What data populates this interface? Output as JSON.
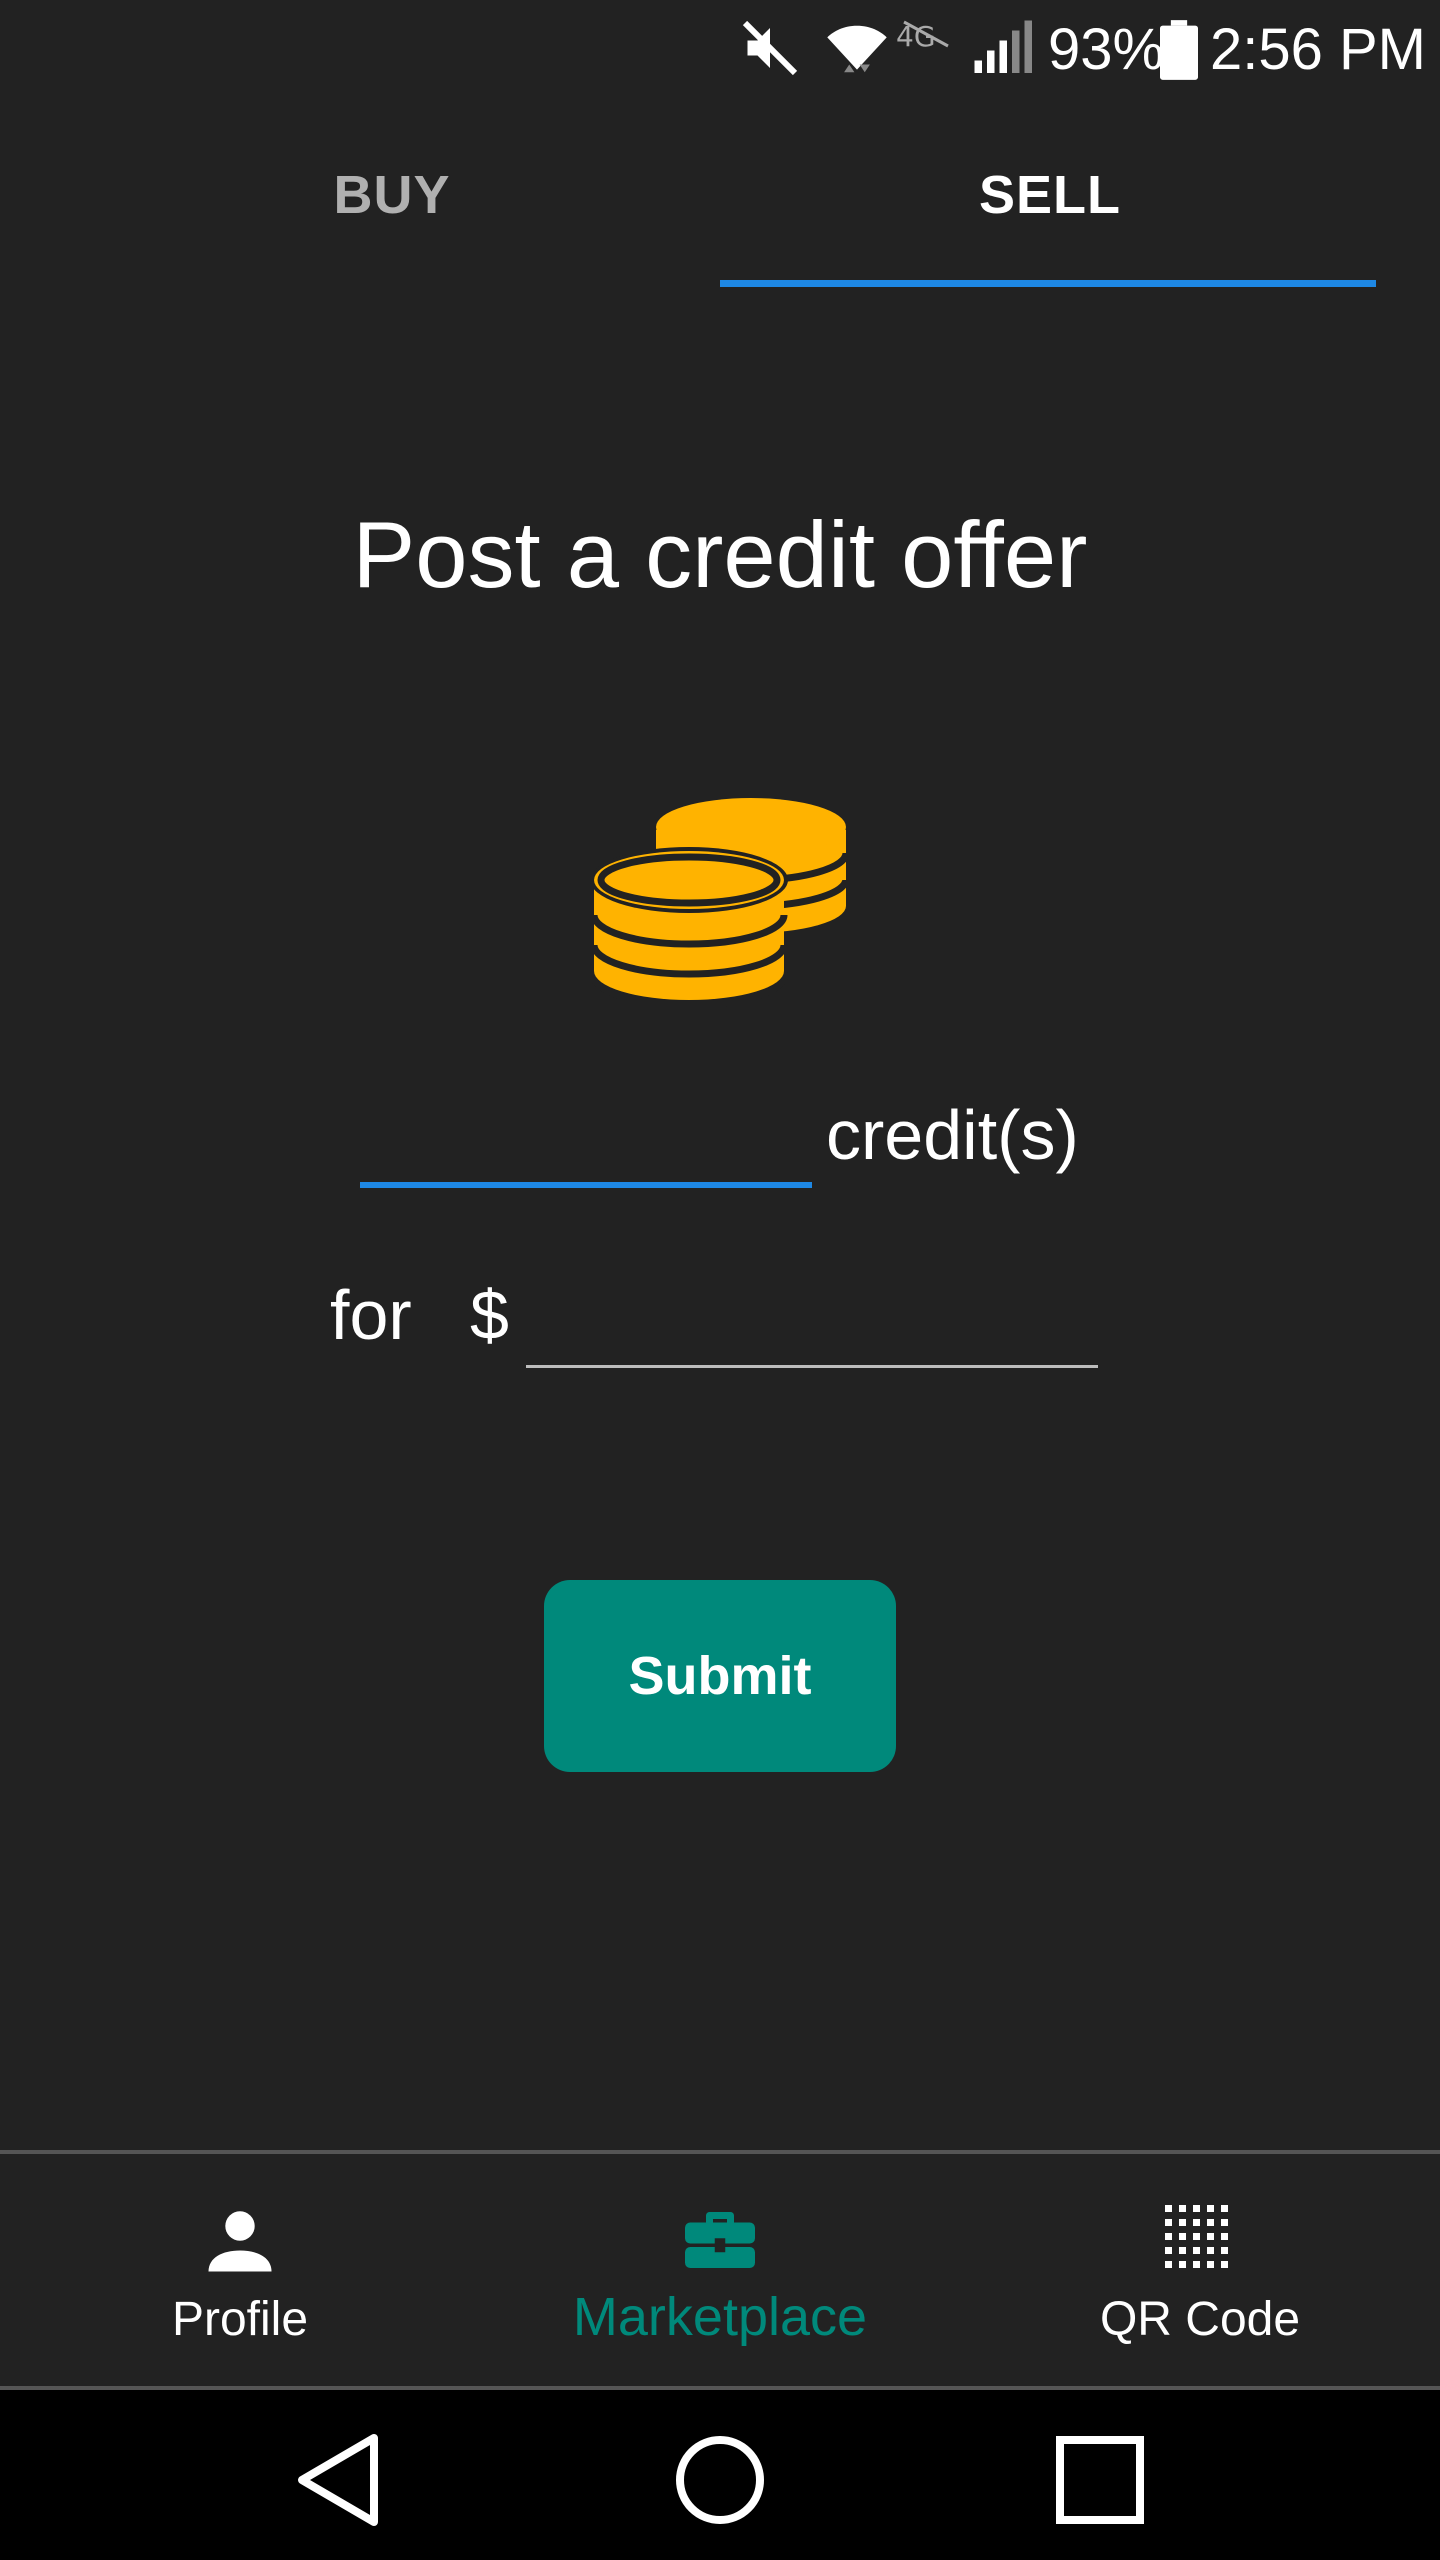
{
  "status_bar": {
    "battery": "93%",
    "time": "2:56 PM",
    "icons": [
      "mute-icon",
      "wifi-icon",
      "lte-icon",
      "signal-icon",
      "battery-icon"
    ]
  },
  "tabs": [
    {
      "label": "BUY",
      "selected": false
    },
    {
      "label": "SELL",
      "selected": true
    }
  ],
  "main": {
    "title": "Post a credit offer",
    "icon": "coins-icon",
    "credit_value": "",
    "credit_unit": "credit(s)",
    "for_label": "for",
    "currency_symbol": "$",
    "price_value": "",
    "submit_label": "Submit"
  },
  "bottom_nav": [
    {
      "label": "Profile",
      "icon": "person-icon",
      "active": false
    },
    {
      "label": "Marketplace",
      "icon": "briefcase-icon",
      "active": true
    },
    {
      "label": "QR Code",
      "icon": "qr-code-icon",
      "active": false
    }
  ],
  "system_nav": [
    "back-icon",
    "home-icon",
    "recents-icon"
  ],
  "colors": {
    "background": "#222222",
    "accent_blue": "#1e88e5",
    "teal": "#00897b",
    "coin": "#ffb300"
  }
}
